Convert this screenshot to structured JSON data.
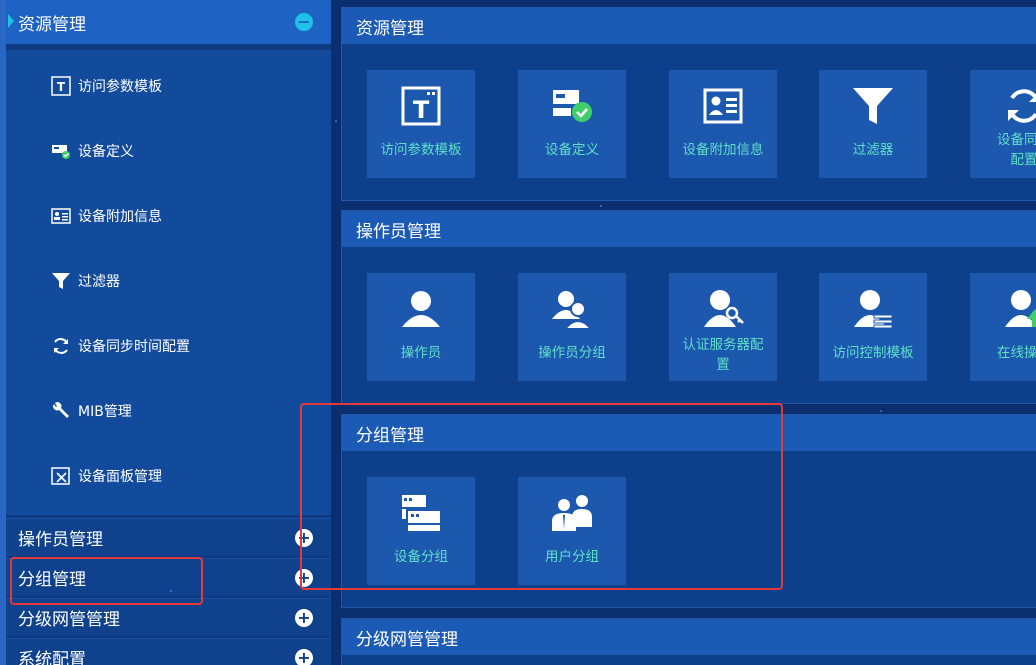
{
  "sidebar": {
    "active_section": "资源管理",
    "resource_items": [
      {
        "label": "访问参数模板",
        "icon": "template-icon"
      },
      {
        "label": "设备定义",
        "icon": "device-check-icon"
      },
      {
        "label": "设备附加信息",
        "icon": "id-card-icon"
      },
      {
        "label": "过滤器",
        "icon": "filter-icon"
      },
      {
        "label": "设备同步时间配置",
        "icon": "sync-icon"
      },
      {
        "label": "MIB管理",
        "icon": "wrench-icon"
      },
      {
        "label": "设备面板管理",
        "icon": "panel-icon"
      }
    ],
    "sections": [
      {
        "label": "操作员管理"
      },
      {
        "label": "分组管理"
      },
      {
        "label": "分级网管管理"
      },
      {
        "label": "系统配置"
      }
    ]
  },
  "panels": [
    {
      "title": "资源管理",
      "tiles": [
        {
          "label": "访问参数模板",
          "icon": "template-icon"
        },
        {
          "label": "设备定义",
          "icon": "device-check-icon"
        },
        {
          "label": "设备附加信息",
          "icon": "id-card-icon"
        },
        {
          "label": "过滤器",
          "icon": "filter-icon"
        },
        {
          "label": "设备同步",
          "label2": "配置",
          "icon": "sync-icon"
        }
      ]
    },
    {
      "title": "操作员管理",
      "tiles": [
        {
          "label": "操作员",
          "icon": "user-icon"
        },
        {
          "label": "操作员分组",
          "icon": "users-icon"
        },
        {
          "label": "认证服务器配",
          "label2": "置",
          "icon": "user-key-icon"
        },
        {
          "label": "访问控制模板",
          "icon": "user-access-icon"
        },
        {
          "label": "在线操作",
          "icon": "user-online-icon"
        }
      ]
    },
    {
      "title": "分组管理",
      "tiles": [
        {
          "label": "设备分组",
          "icon": "device-group-icon"
        },
        {
          "label": "用户分组",
          "icon": "user-group-icon"
        }
      ]
    },
    {
      "title": "分级网管管理",
      "tiles": []
    }
  ],
  "colors": {
    "background": "#0b2f6e",
    "tile": "#1c58ae",
    "tile_label": "#5ee0c8",
    "accent": "#1fc1e7",
    "highlight_box": "#e43a3a"
  }
}
